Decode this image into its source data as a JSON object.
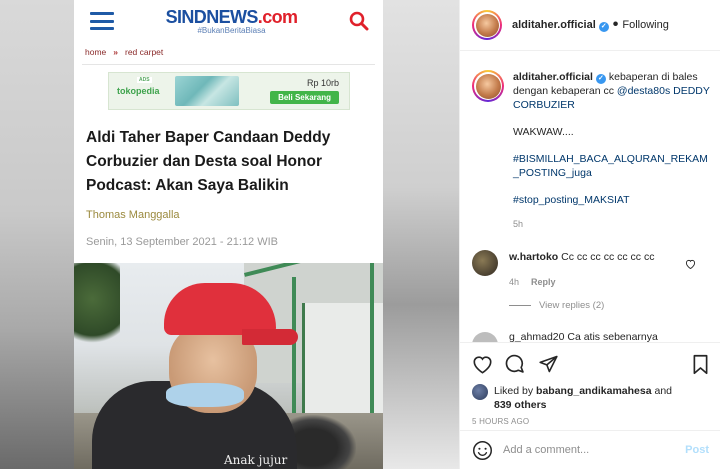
{
  "article": {
    "logo_part1": "SIND",
    "logo_part2": "NEWS",
    "logo_part3": ".com",
    "tagline": "#BukanBeritaBiasa",
    "breadcrumb": [
      "home",
      "red carpet"
    ],
    "breadcrumb_sep": "»",
    "ad": {
      "brand": "tokopedia",
      "brand_tag": "ADS",
      "price": "Rp 10rb",
      "cta": "Beli Sekarang"
    },
    "headline": "Aldi Taher Baper Candaan Deddy Corbuzier dan Desta soal Honor Podcast: Akan Saya Balikin",
    "author": "Thomas Manggalla",
    "date": "Senin, 13 September 2021 - 21:12 WIB",
    "shirt_text": "Anak jujur"
  },
  "instagram": {
    "username": "alditaher.official",
    "follow_status": "Following",
    "caption": {
      "username": "alditaher.official",
      "text": "kebaperan di bales dengan kebaperan cc",
      "mention_line": "@desta80s DEDDY CORBUZIER",
      "line2": "WAKWAW....",
      "hashtag1": "#BISMILLAH_BACA_ALQURAN_REKAM_POSTING_juga",
      "hashtag2": "#stop_posting_MAKSIAT",
      "time": "5h"
    },
    "comment": {
      "username": "w.hartoko",
      "text": "Cc cc cc cc cc cc cc",
      "time": "4h",
      "reply_label": "Reply"
    },
    "view_replies": "View replies (2)",
    "peek_comment": "g_ahmad20 Ca atis sebenarnya",
    "likes": {
      "prefix": "Liked by",
      "user": "babang_andikamahesa",
      "suffix": "and",
      "others": "839 others"
    },
    "post_time": "5 HOURS AGO",
    "add_comment_placeholder": "Add a comment...",
    "post_label": "Post"
  }
}
